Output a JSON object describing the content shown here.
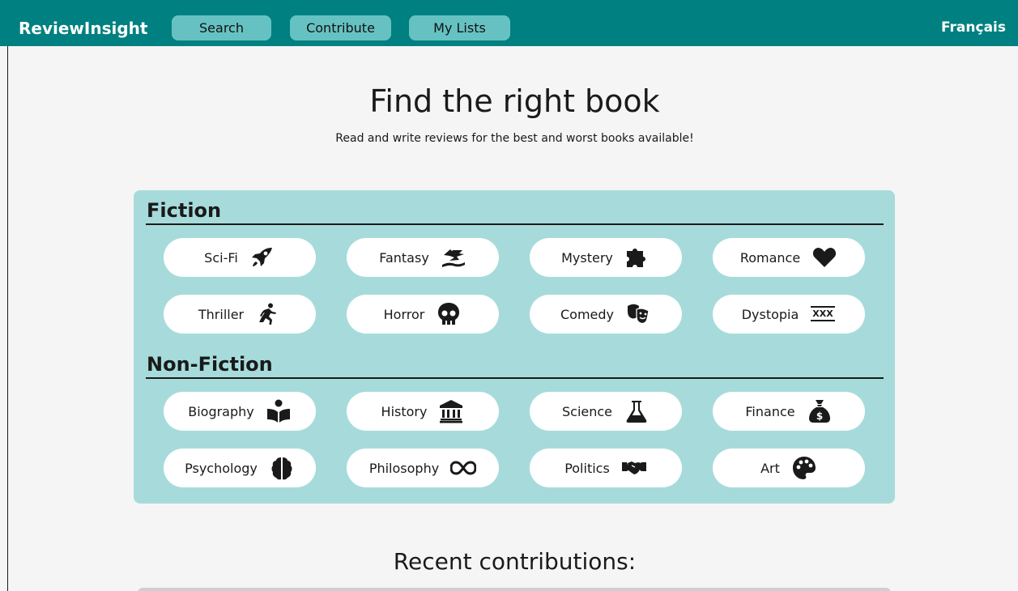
{
  "nav": {
    "brand": "ReviewInsight",
    "buttons": [
      "Search",
      "Contribute",
      "My Lists"
    ],
    "language": "Français"
  },
  "hero": {
    "title": "Find the right book",
    "subtitle": "Read and write reviews for the best and worst books available!"
  },
  "fiction": {
    "title": "Fiction",
    "genres": [
      {
        "label": "Sci-Fi",
        "icon": "rocket-icon"
      },
      {
        "label": "Fantasy",
        "icon": "dragon-icon"
      },
      {
        "label": "Mystery",
        "icon": "puzzle-icon"
      },
      {
        "label": "Romance",
        "icon": "heart-icon"
      },
      {
        "label": "Thriller",
        "icon": "running-icon"
      },
      {
        "label": "Horror",
        "icon": "skull-icon"
      },
      {
        "label": "Comedy",
        "icon": "masks-icon"
      },
      {
        "label": "Dystopia",
        "icon": "xxx-icon"
      }
    ]
  },
  "nonfiction": {
    "title": "Non-Fiction",
    "genres": [
      {
        "label": "Biography",
        "icon": "reader-icon"
      },
      {
        "label": "History",
        "icon": "landmark-icon"
      },
      {
        "label": "Science",
        "icon": "flask-icon"
      },
      {
        "label": "Finance",
        "icon": "money-bag-icon"
      },
      {
        "label": "Psychology",
        "icon": "brain-icon"
      },
      {
        "label": "Philosophy",
        "icon": "infinity-icon"
      },
      {
        "label": "Politics",
        "icon": "handshake-icon"
      },
      {
        "label": "Art",
        "icon": "palette-icon"
      }
    ]
  },
  "recent": {
    "title": "Recent contributions:"
  },
  "colors": {
    "navbar": "#008080",
    "nav_button": "#66c2c2",
    "panel": "#a7dbdb",
    "page_background": "#f5f5f5"
  }
}
